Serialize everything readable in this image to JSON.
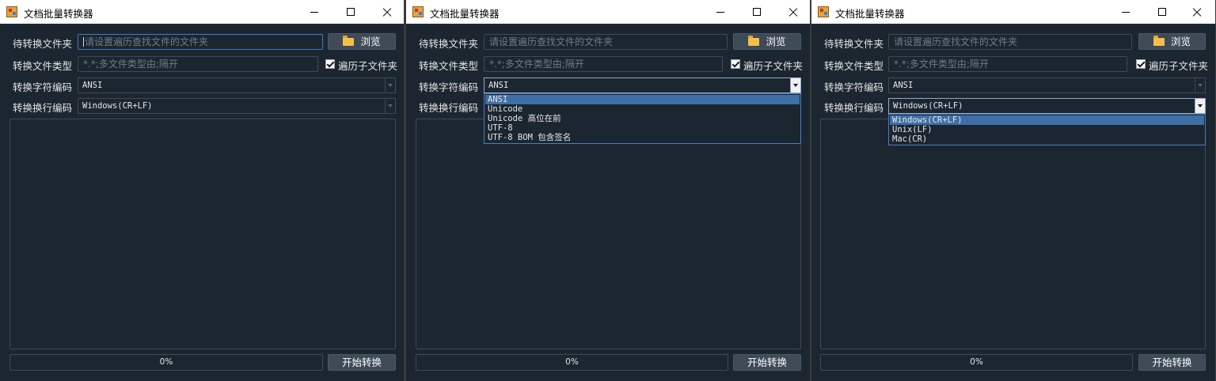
{
  "app_title": "文档批量转换器",
  "labels": {
    "source_folder": "待转换文件夹",
    "file_types": "转换文件类型",
    "charset": "转换字符编码",
    "line_ending": "转换换行编码"
  },
  "folder_placeholder": "请设置遍历查找文件的文件夹",
  "types_placeholder": "*.*;多文件类型由;隔开",
  "browse_label": "浏览",
  "subfolders_label": "遍历子文件夹",
  "subfolders_checked": true,
  "charset_value": "ANSI",
  "line_ending_value": "Windows(CR+LF)",
  "progress_text": "0%",
  "progress_fraction": 0.0,
  "start_label": "开始转换",
  "charset_options": [
    "ANSI",
    "Unicode",
    "Unicode 高位在前",
    "UTF-8",
    "UTF-8 BOM 包含签名"
  ],
  "line_ending_options": [
    "Windows(CR+LF)",
    "Unix(LF)",
    "Mac(CR)"
  ]
}
